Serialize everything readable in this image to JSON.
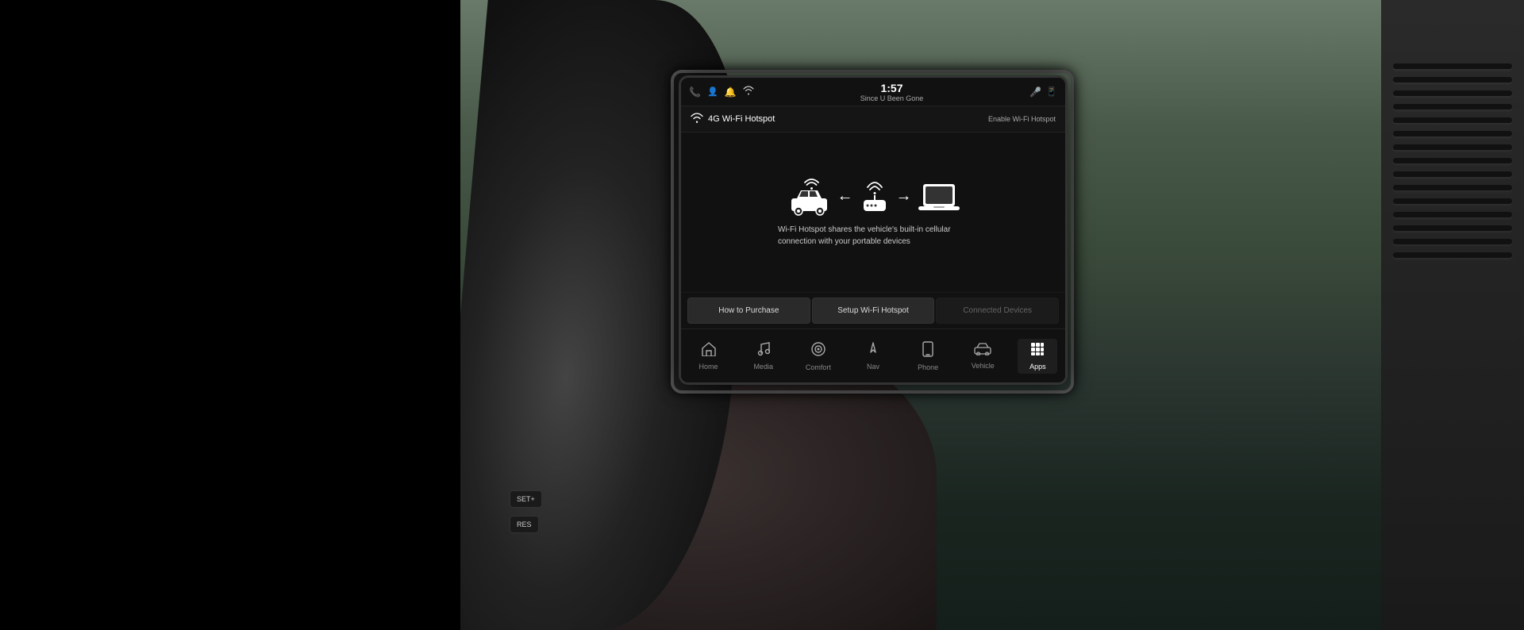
{
  "scene": {
    "background": "car interior with infotainment screen"
  },
  "screen": {
    "status_bar": {
      "icons": [
        "phone",
        "person",
        "bell",
        "wifi"
      ],
      "time": "1:57",
      "song": "Since U Been Gone",
      "right_icons": [
        "microphone",
        "phone"
      ]
    },
    "header": {
      "wifi_label": "4G Wi-Fi Hotspot",
      "enable_label": "Enable Wi-Fi Hotspot"
    },
    "main": {
      "description": "Wi-Fi Hotspot shares the vehicle's built-in cellular connection with your portable devices"
    },
    "buttons": [
      {
        "label": "How to Purchase",
        "disabled": false
      },
      {
        "label": "Setup Wi-Fi Hotspot",
        "disabled": false
      },
      {
        "label": "Connected Devices",
        "disabled": true
      }
    ],
    "nav_items": [
      {
        "label": "Home",
        "icon": "house",
        "active": false
      },
      {
        "label": "Media",
        "icon": "music-note",
        "active": false
      },
      {
        "label": "Comfort",
        "icon": "circle-dot",
        "active": false
      },
      {
        "label": "Nav",
        "icon": "triangle-up",
        "active": false
      },
      {
        "label": "Phone",
        "icon": "phone-outline",
        "active": false
      },
      {
        "label": "Vehicle",
        "icon": "car-outline",
        "active": false
      },
      {
        "label": "Apps",
        "icon": "grid",
        "active": true
      }
    ]
  },
  "controls": {
    "set_plus": "SET+",
    "res": "RES"
  }
}
